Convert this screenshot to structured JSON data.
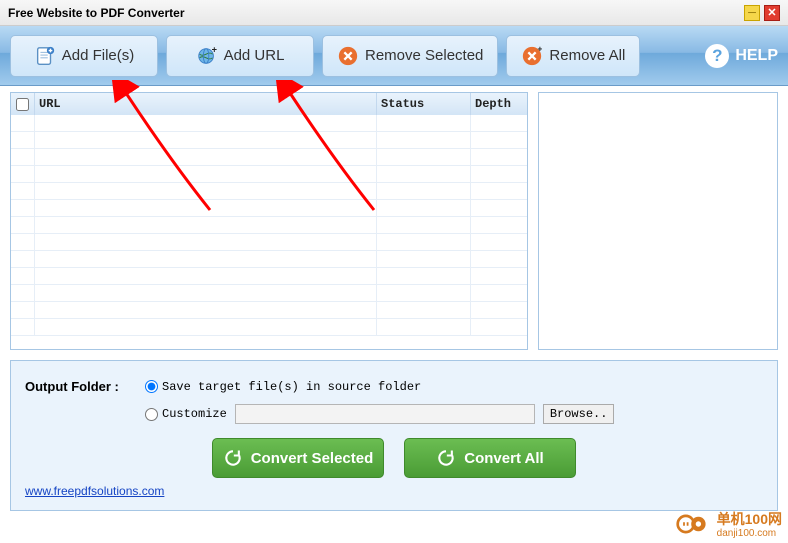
{
  "window": {
    "title": "Free Website to PDF Converter"
  },
  "toolbar": {
    "add_files": "Add File(s)",
    "add_url": "Add URL",
    "remove_selected": "Remove Selected",
    "remove_all": "Remove All",
    "help": "HELP"
  },
  "table": {
    "headers": {
      "url": "URL",
      "status": "Status",
      "depth": "Depth"
    },
    "rows": []
  },
  "output": {
    "label": "Output Folder :",
    "save_source": "Save target file(s) in source folder",
    "customize": "Customize",
    "browse": "Browse..",
    "path": ""
  },
  "actions": {
    "convert_selected": "Convert Selected",
    "convert_all": "Convert All"
  },
  "footer": {
    "link": "www.freepdfsolutions.com"
  },
  "watermark": {
    "name": "单机100网",
    "url": "danji100.com"
  }
}
